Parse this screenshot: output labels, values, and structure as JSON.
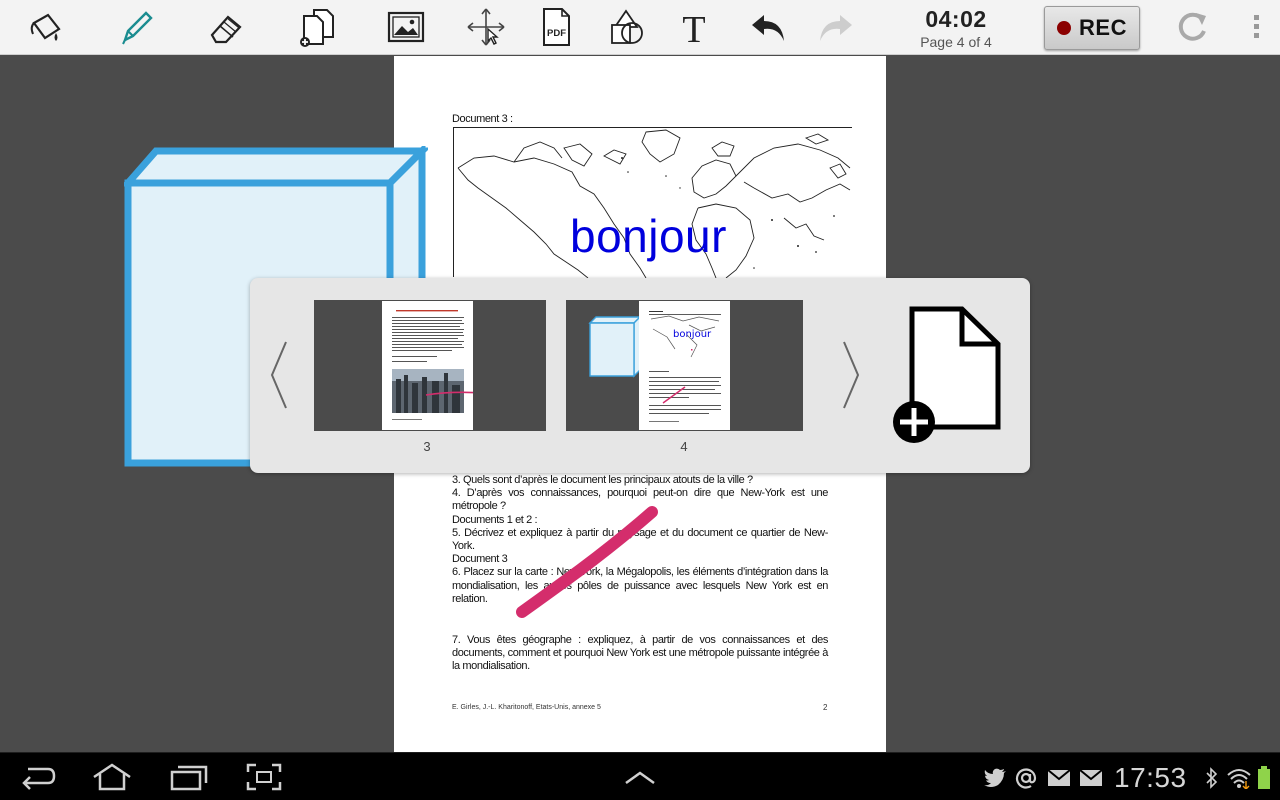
{
  "toolbar": {
    "tools": [
      {
        "name": "paint-bucket-tool"
      },
      {
        "name": "pen-tool"
      },
      {
        "name": "eraser-tool"
      },
      {
        "name": "add-page-tool"
      },
      {
        "name": "image-tool"
      },
      {
        "name": "move-tool"
      },
      {
        "name": "pdf-tool"
      },
      {
        "name": "shapes-tool"
      },
      {
        "name": "text-tool"
      },
      {
        "name": "undo-button"
      },
      {
        "name": "redo-button"
      }
    ],
    "timer": "04:02",
    "page_indicator": "Page 4 of 4",
    "rec_label": "REC"
  },
  "document": {
    "heading": "Document 3 :",
    "annotation": "bonjour",
    "questions": [
      "3. Quels sont d’après le document les principaux atouts de la ville ?",
      "4. D’après vos connaissances, pourquoi peut-on dire que New-York est une métropole ?",
      "Documents 1 et 2 :",
      "5. Décrivez et expliquez à partir du paysage et du document ce quartier de New-York.",
      "Document 3",
      "6. Placez sur la carte : New York, la Mégalopolis, les éléments d’intégration dans la mondialisation, les autres pôles de puissance avec lesquels New York est en relation."
    ],
    "question_7": "7. Vous êtes géographe : expliquez, à partir de vos connaissances et des documents, comment et pourquoi New York est une métropole puissante intégrée à la mondialisation.",
    "footer_left": "E. Girles, J.-L. Kharitonoff, Etats-Unis, annexe 5",
    "footer_right": "2"
  },
  "page_strip": {
    "pages": [
      {
        "number": "3"
      },
      {
        "number": "4"
      }
    ],
    "thumb_annotation": "bonjour"
  },
  "navbar": {
    "clock": "17:53"
  },
  "colors": {
    "annotation_blue": "#0000dd",
    "pen_pink": "#d42d6c",
    "cube_blue": "#3aa1dc",
    "rec_dot": "#8b0000"
  }
}
